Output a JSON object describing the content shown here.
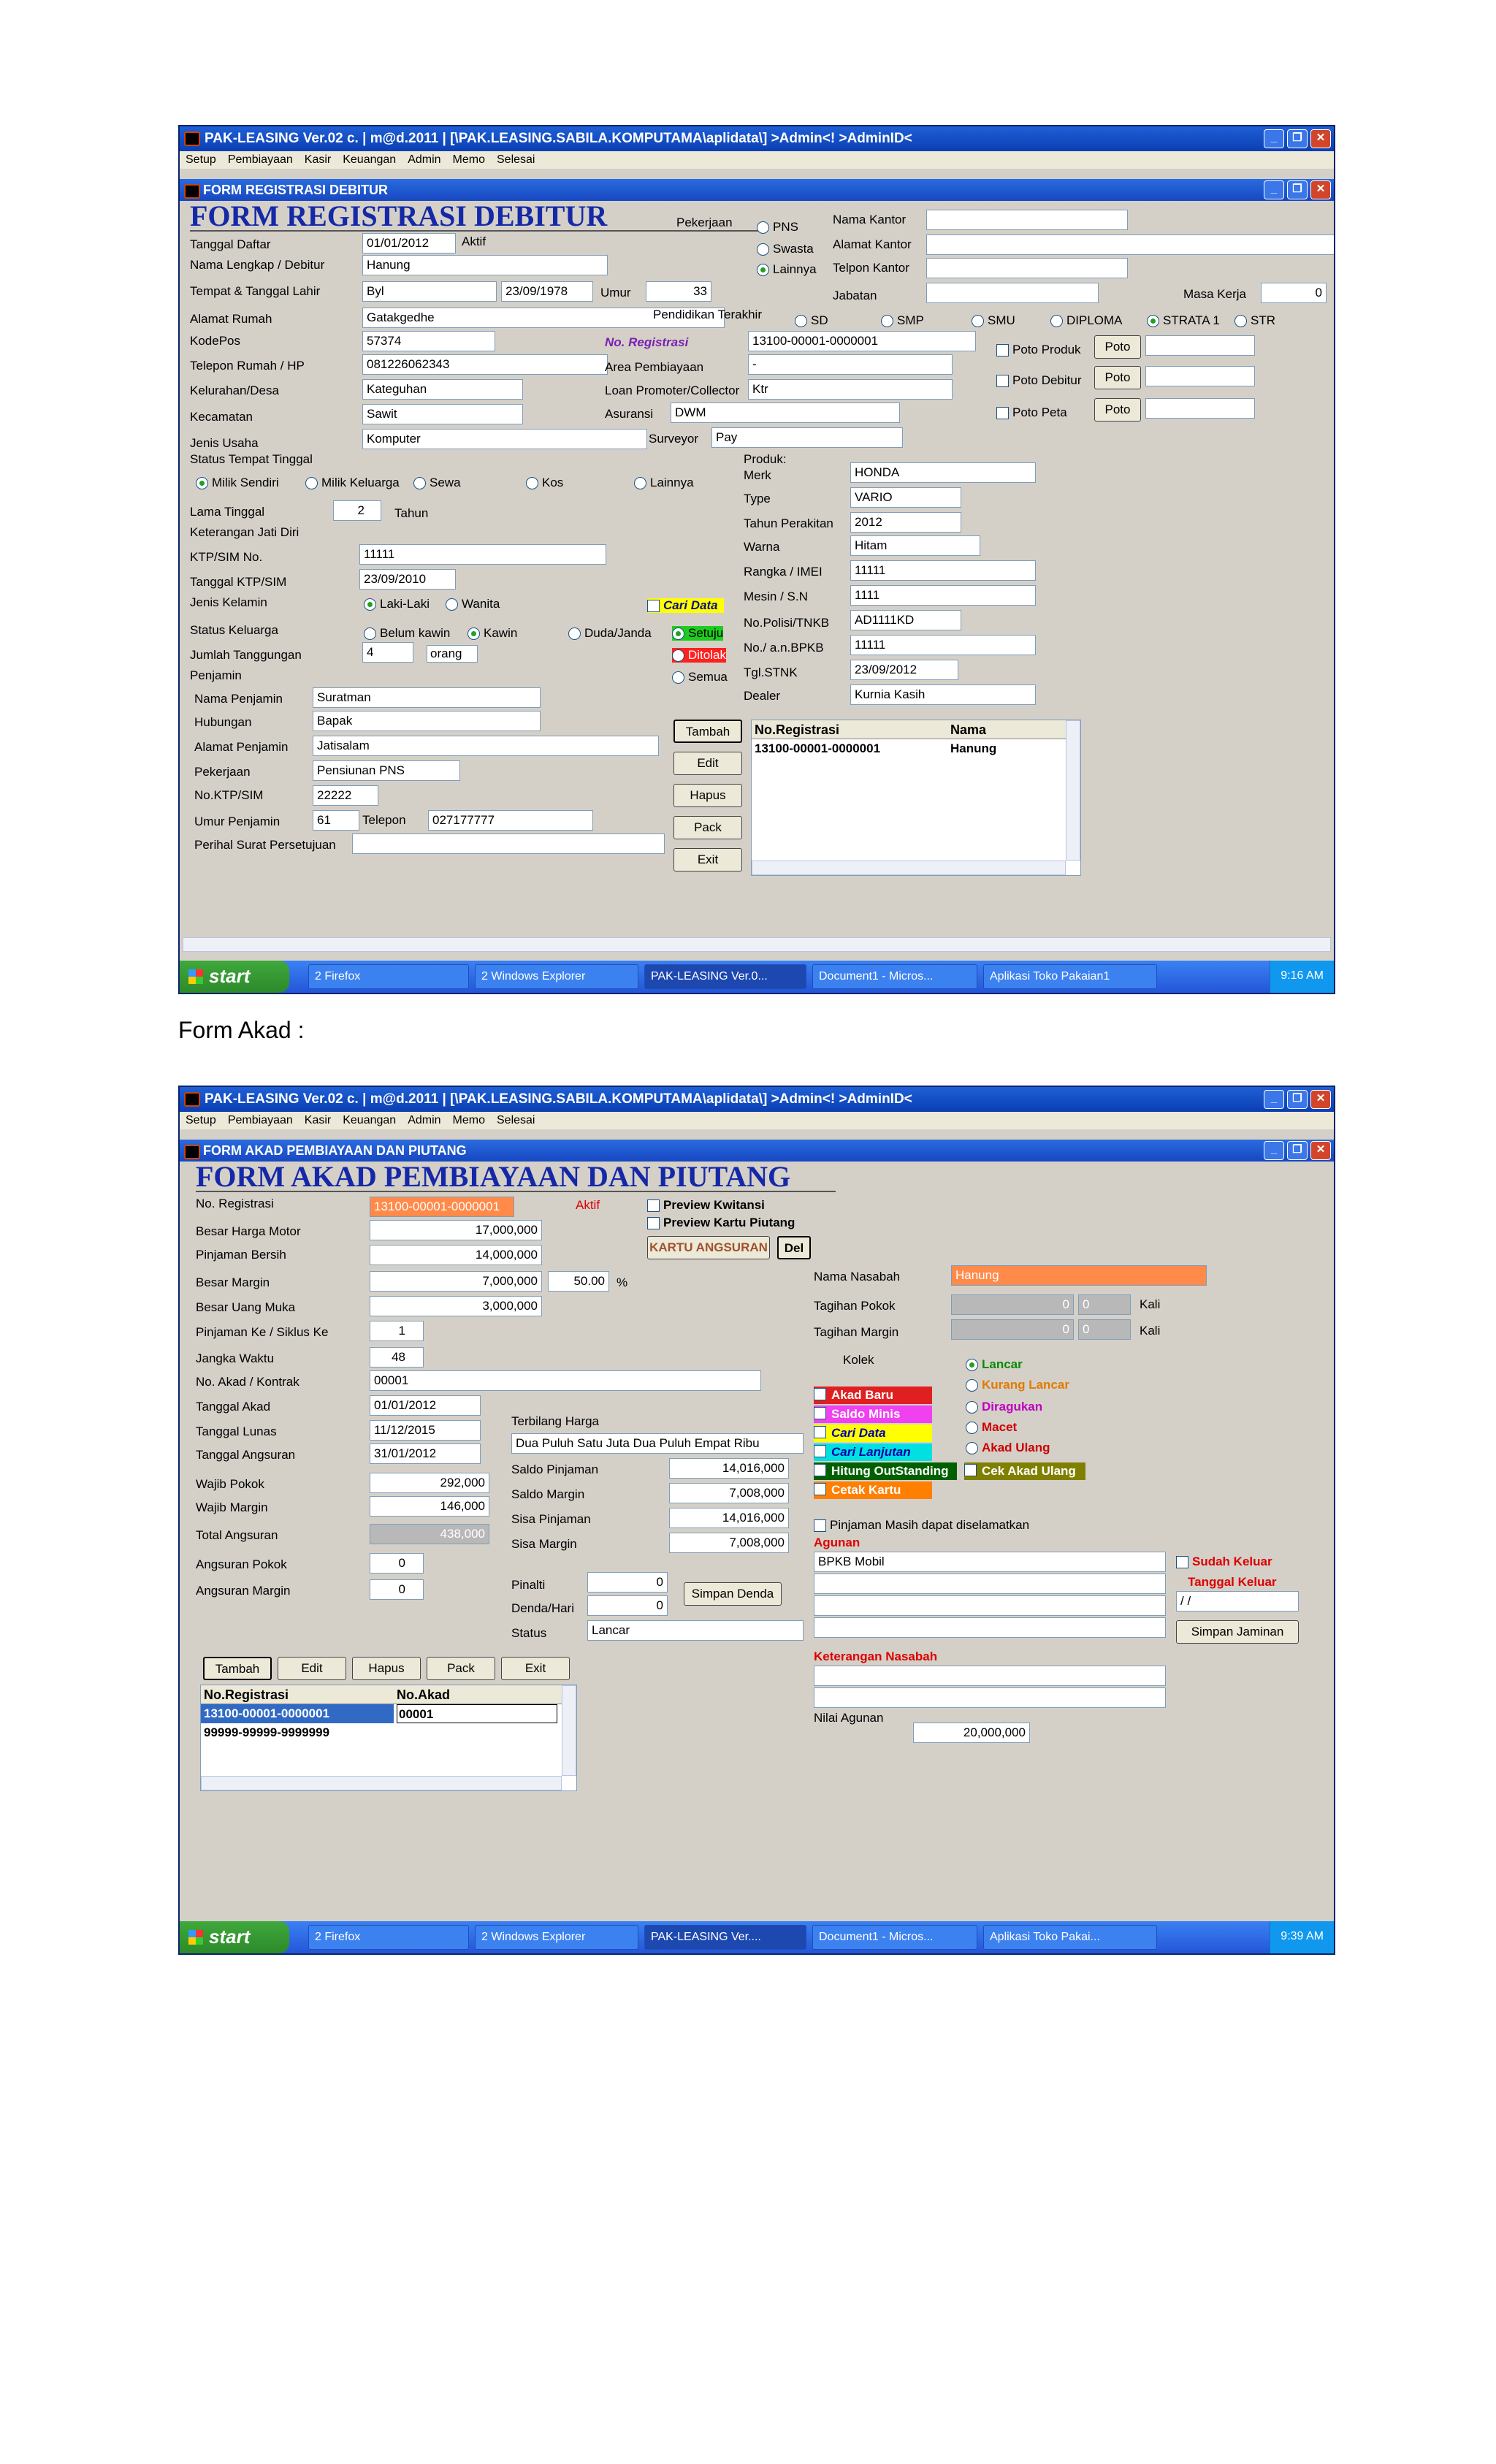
{
  "form1": {
    "window_title": "PAK-LEASING Ver.02 c. | m@d.2011 | [\\PAK.LEASING.SABILA.KOMPUTAMA\\aplidata\\] >Admin<! >AdminID<",
    "menu": [
      "Setup",
      "Pembiayaan",
      "Kasir",
      "Keuangan",
      "Admin",
      "Memo",
      "Selesai"
    ],
    "form_window_title": "FORM REGISTRASI DEBITUR",
    "form_title": "FORM REGISTRASI DEBITUR",
    "labels": {
      "tanggal_daftar": "Tanggal Daftar",
      "aktif": "Aktif",
      "nama": "Nama Lengkap / Debitur",
      "tempat_tgl": "Tempat & Tanggal Lahir",
      "umur": "Umur",
      "alamat": "Alamat Rumah",
      "kodepos": "KodePos",
      "telepon": "Telepon Rumah / HP",
      "kelurahan": "Kelurahan/Desa",
      "kecamatan": "Kecamatan",
      "jenis_usaha": "Jenis Usaha",
      "status_tempat": "Status Tempat Tinggal",
      "lama_tinggal": "Lama Tinggal",
      "tahun": "Tahun",
      "keterangan_jati": "Keterangan Jati Diri",
      "ktp": "KTP/SIM No.",
      "tgl_ktp": "Tanggal KTP/SIM",
      "jenis_kelamin": "Jenis Kelamin",
      "status_keluarga": "Status Keluarga",
      "jumlah_tanggungan": "Jumlah Tanggungan",
      "orang": "orang",
      "penjamin": "Penjamin",
      "nama_penjamin": "Nama Penjamin",
      "hubungan": "Hubungan",
      "alamat_penjamin": "Alamat Penjamin",
      "pekerjaan_penjamin": "Pekerjaan",
      "ktp_penjamin": "No.KTP/SIM",
      "umur_penjamin": "Umur Penjamin",
      "telepon_penjamin": "Telepon",
      "perihal": "Perihal Surat Persetujuan",
      "pekerjaan": "Pekerjaan",
      "nama_kantor": "Nama Kantor",
      "alamat_kantor": "Alamat Kantor",
      "telpon_kantor": "Telpon Kantor",
      "jabatan": "Jabatan",
      "masa_kerja": "Masa Kerja",
      "pendidikan": "Pendidikan Terakhir",
      "no_registrasi": "No. Registrasi",
      "area": "Area Pembiayaan",
      "loan_promoter": "Loan Promoter/Collector",
      "asuransi": "Asuransi",
      "surveyor": "Surveyor",
      "produk": "Produk:",
      "merk": "Merk",
      "type": "Type",
      "tahun_perakitan": "Tahun Perakitan",
      "warna": "Warna",
      "rangka": "Rangka / IMEI",
      "mesin": "Mesin / S.N",
      "nopol": "No.Polisi/TNKB",
      "no_bpkb": "No./ a.n.BPKB",
      "tgl_stnk": "Tgl.STNK",
      "dealer": "Dealer",
      "cari_data": "Cari Data"
    },
    "values": {
      "tanggal_daftar": "01/01/2012",
      "nama": "Hanung",
      "tempat": "Byl",
      "tgl_lahir": "23/09/1978",
      "umur": "33",
      "alamat": "Gatakgedhe",
      "kodepos": "57374",
      "telepon": "081226062343",
      "kelurahan": "Kateguhan",
      "kecamatan": "Sawit",
      "jenis_usaha": "Komputer",
      "lama_tinggal": "2",
      "ktp": "11111",
      "tgl_ktp": "23/09/2010",
      "jumlah_tanggungan": "4",
      "nama_penjamin": "Suratman",
      "hubungan": "Bapak",
      "alamat_penjamin": "Jatisalam",
      "pekerjaan_penjamin": "Pensiunan PNS",
      "ktp_penjamin": "22222",
      "umur_penjamin": "61",
      "telepon_penjamin": "027177777",
      "masa_kerja": "0",
      "no_registrasi": "13100-00001-0000001",
      "area": "-",
      "loan_promoter": "Ktr",
      "asuransi": "DWM",
      "surveyor": "Pay",
      "merk": "HONDA",
      "type": "VARIO",
      "tahun_perakitan": "2012",
      "warna": "Hitam",
      "rangka": "11111",
      "mesin": "1111",
      "nopol": "AD1111KD",
      "no_bpkb": "11111",
      "tgl_stnk": "23/09/2012",
      "dealer": "Kurnia Kasih"
    },
    "pekerjaan_options": [
      "PNS",
      "Swasta",
      "Lainnya"
    ],
    "pendidikan_options": [
      "SD",
      "SMP",
      "SMU",
      "DIPLOMA",
      "STRATA 1",
      "STR"
    ],
    "status_tempat_options": [
      "Milik Sendiri",
      "Milik Keluarga",
      "Sewa",
      "Kos",
      "Lainnya"
    ],
    "kelamin_options": [
      "Laki-Laki",
      "Wanita"
    ],
    "status_keluarga_options": [
      "Belum kawin",
      "Kawin",
      "Duda/Janda"
    ],
    "persetujuan_options": [
      "Setuju",
      "Ditolak",
      "Semua"
    ],
    "poto": [
      {
        "label": "Poto Produk",
        "btn": "Poto"
      },
      {
        "label": "Poto Debitur",
        "btn": "Poto"
      },
      {
        "label": "Poto Peta",
        "btn": "Poto"
      }
    ],
    "buttons": [
      "Tambah",
      "Edit",
      "Hapus",
      "Pack",
      "Exit"
    ],
    "grid": {
      "headers": [
        "No.Registrasi",
        "Nama"
      ],
      "rows": [
        [
          "13100-00001-0000001",
          "Hanung"
        ]
      ]
    },
    "taskbar": {
      "start": "start",
      "tasks": [
        "2 Firefox",
        "2 Windows Explorer",
        "PAK-LEASING Ver.0...",
        "Document1 - Micros...",
        "Aplikasi Toko Pakaian1"
      ],
      "clock": "9:16 AM"
    }
  },
  "caption": "Form Akad :",
  "form2": {
    "window_title": "PAK-LEASING Ver.02 c. | m@d.2011 | [\\PAK.LEASING.SABILA.KOMPUTAMA\\aplidata\\] >Admin<! >AdminID<",
    "menu": [
      "Setup",
      "Pembiayaan",
      "Kasir",
      "Keuangan",
      "Admin",
      "Memo",
      "Selesai"
    ],
    "form_window_title": "FORM AKAD PEMBIAYAAN DAN PIUTANG",
    "form_title": "FORM AKAD PEMBIAYAAN DAN PIUTANG",
    "labels": {
      "no_registrasi": "No. Registrasi",
      "aktif": "Aktif",
      "harga_motor": "Besar Harga Motor",
      "pinjaman_bersih": "Pinjaman Bersih",
      "besar_margin": "Besar Margin",
      "pct": "%",
      "uang_muka": "Besar Uang Muka",
      "pinjaman_ke": "Pinjaman Ke / Siklus Ke",
      "jangka": "Jangka Waktu",
      "no_akad": "No. Akad / Kontrak",
      "tgl_akad": "Tanggal Akad",
      "tgl_lunas": "Tanggal Lunas",
      "tgl_angsuran": "Tanggal Angsuran",
      "wajib_pokok": "Wajib Pokok",
      "wajib_margin": "Wajib Margin",
      "total_angsuran": "Total Angsuran",
      "angsuran_pokok": "Angsuran Pokok",
      "angsuran_margin": "Angsuran Margin",
      "terbilang": "Terbilang Harga",
      "saldo_pinjaman": "Saldo Pinjaman",
      "saldo_margin": "Saldo Margin",
      "sisa_pinjaman": "Sisa Pinjaman",
      "sisa_margin": "Sisa Margin",
      "pinalti": "Pinalti",
      "denda_hari": "Denda/Hari",
      "status": "Status",
      "preview_kwitansi": "Preview Kwitansi",
      "preview_kartu": "Preview Kartu Piutang",
      "kartu_angsuran": "KARTU ANGSURAN",
      "del": "Del",
      "nama_nasabah": "Nama Nasabah",
      "tagihan_pokok": "Tagihan Pokok",
      "tagihan_margin": "Tagihan Margin",
      "kali": "Kali",
      "kolek": "Kolek",
      "pinjaman_masih": "Pinjaman Masih dapat diselamatkan",
      "agunan": "Agunan",
      "sudah_keluar": "Sudah Keluar",
      "tanggal_keluar": "Tanggal Keluar",
      "simpan_jaminan": "Simpan Jaminan",
      "keterangan_nasabah": "Keterangan Nasabah",
      "nilai_agunan": "Nilai Agunan",
      "simpan_denda": "Simpan Denda"
    },
    "values": {
      "no_registrasi": "13100-00001-0000001",
      "harga_motor": "17,000,000",
      "pinjaman_bersih": "14,000,000",
      "besar_margin": "7,000,000",
      "margin_pct": "50.00",
      "uang_muka": "3,000,000",
      "pinjaman_ke": "1",
      "jangka": "48",
      "no_akad": "00001",
      "tgl_akad": "01/01/2012",
      "tgl_lunas": "11/12/2015",
      "tgl_angsuran": "31/01/2012",
      "wajib_pokok": "292,000",
      "wajib_margin": "146,000",
      "total_angsuran": "438,000",
      "angsuran_pokok": "0",
      "angsuran_margin": "0",
      "terbilang": "Dua Puluh Satu Juta Dua Puluh Empat Ribu",
      "saldo_pinjaman": "14,016,000",
      "saldo_margin": "7,008,000",
      "sisa_pinjaman": "14,016,000",
      "sisa_margin": "7,008,000",
      "pinalti": "0",
      "denda_hari": "0",
      "status": "Lancar",
      "nama_nasabah": "Hanung",
      "tagihan_pokok": "0",
      "tagihan_pokok_kali": "0",
      "tagihan_margin": "0",
      "tagihan_margin_kali": "0",
      "agunan": "BPKB Mobil",
      "tanggal_keluar": "/ /",
      "nilai_agunan": "20,000,000"
    },
    "kolek_options": [
      {
        "label": "Lancar",
        "color": "#0a8a0a"
      },
      {
        "label": "Kurang Lancar",
        "color": "#e07a00"
      },
      {
        "label": "Diragukan",
        "color": "#c000c0"
      },
      {
        "label": "Macet",
        "color": "#cc0000"
      },
      {
        "label": "Akad Ulang",
        "color": "#cc0000"
      }
    ],
    "sections": [
      {
        "label": "Akad Baru",
        "color": "#e02020",
        "text": "#fff"
      },
      {
        "label": "Saldo Minis",
        "color": "#f040f0",
        "text": "#fff"
      },
      {
        "label": "Cari Data",
        "color": "#ffff00",
        "text": "#00a"
      },
      {
        "label": "Cari Lanjutan",
        "color": "#00e0e0",
        "text": "#00a"
      },
      {
        "label": "Hitung OutStanding",
        "color": "#006000",
        "text": "#fff"
      },
      {
        "label": "Cetak Kartu",
        "color": "#ff8000",
        "text": "#fff"
      }
    ],
    "cek_akad_ulang": "Cek Akad Ulang",
    "buttons": [
      "Tambah",
      "Edit",
      "Hapus",
      "Pack",
      "Exit"
    ],
    "grid": {
      "headers": [
        "No.Registrasi",
        "No.Akad"
      ],
      "rows": [
        [
          "13100-00001-0000001",
          "00001"
        ],
        [
          "99999-99999-9999999",
          ""
        ]
      ]
    },
    "taskbar": {
      "start": "start",
      "tasks": [
        "2 Firefox",
        "2 Windows Explorer",
        "PAK-LEASING Ver....",
        "Document1 - Micros...",
        "Aplikasi Toko Pakai..."
      ],
      "clock": "9:39 AM"
    }
  }
}
